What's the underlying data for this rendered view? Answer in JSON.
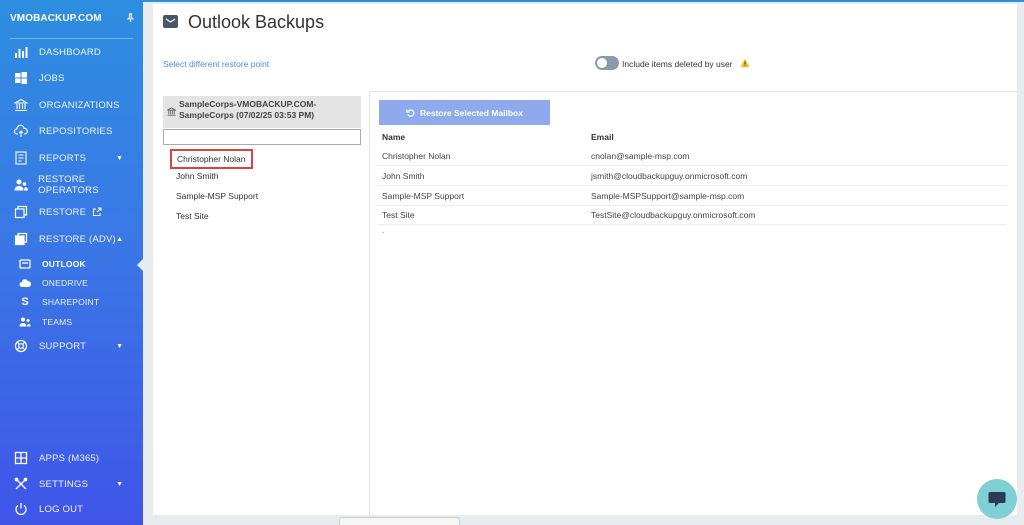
{
  "sidebar": {
    "brand": "VMOBACKUP.COM",
    "items": [
      {
        "label": "DASHBOARD",
        "icon": "chart-bars-icon"
      },
      {
        "label": "JOBS",
        "icon": "windows-icon"
      },
      {
        "label": "ORGANIZATIONS",
        "icon": "bank-icon"
      },
      {
        "label": "REPOSITORIES",
        "icon": "cloud-upload-icon"
      },
      {
        "label": "REPORTS",
        "icon": "report-icon"
      },
      {
        "label": "RESTORE OPERATORS",
        "icon": "users-icon"
      },
      {
        "label": "RESTORE",
        "icon": "restore-icon"
      },
      {
        "label": "RESTORE (ADV)",
        "icon": "restore-adv-icon"
      },
      {
        "label": "SUPPORT",
        "icon": "lifebuoy-icon"
      }
    ],
    "sub_items": [
      {
        "label": "OUTLOOK",
        "icon": "mail-icon"
      },
      {
        "label": "ONEDRIVE",
        "icon": "cloud-icon"
      },
      {
        "label": "SHAREPOINT",
        "icon": "sharepoint-icon"
      },
      {
        "label": "TEAMS",
        "icon": "teams-icon"
      }
    ],
    "bottom_items": [
      {
        "label": "APPS (M365)",
        "icon": "apps-grid-icon"
      },
      {
        "label": "SETTINGS",
        "icon": "tools-icon"
      },
      {
        "label": "LOG OUT",
        "icon": "power-icon"
      }
    ],
    "active_sub": "OUTLOOK"
  },
  "header": {
    "title": "Outlook Backups",
    "restore_point_link": "Select different restore point",
    "toggle_label": "Include items deleted by user",
    "toggle_on": false
  },
  "tree": {
    "root": "SampleCorps-VMOBACKUP.COM-SampleCorps (07/02/25 03:53 PM)",
    "root_line1": "SampleCorps-VMOBACKUP.COM-",
    "root_line2": "SampleCorps (07/02/25 03:53 PM)",
    "search_value": "",
    "items": [
      "Christopher Nolan",
      "John Smith",
      "Sample-MSP Support",
      "Test Site"
    ],
    "selected": "Christopher Nolan"
  },
  "grid": {
    "restore_button": "Restore Selected Mailbox",
    "columns": [
      "Name",
      "Email"
    ],
    "rows": [
      {
        "name": "Christopher Nolan",
        "email": "cnolan@sample-msp.com"
      },
      {
        "name": "John Smith",
        "email": "jsmith@cloudbackupguy.onmicrosoft.com"
      },
      {
        "name": "Sample-MSP Support",
        "email": "Sample-MSPSupport@sample-msp.com"
      },
      {
        "name": "Test Site",
        "email": "TestSite@cloudbackupguy.onmicrosoft.com"
      }
    ]
  },
  "colors": {
    "sidebar_top": "#2d8ee0",
    "sidebar_bottom": "#3f55e8",
    "button": "#8ea9ec",
    "selection_border": "#d9443b",
    "chat": "#7fd0d4"
  }
}
